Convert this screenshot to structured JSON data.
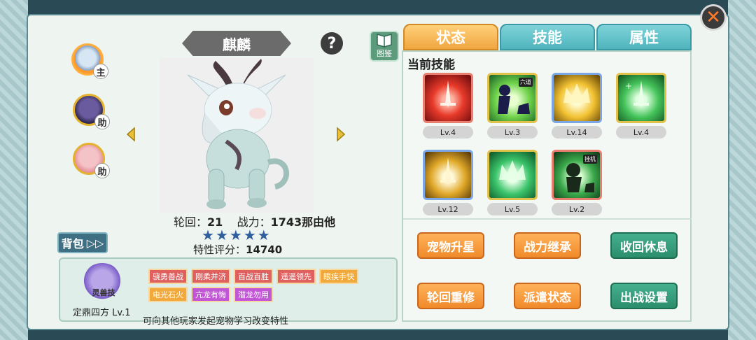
{
  "pet": {
    "name": "麒麟",
    "reincarnation_label": "轮回：",
    "reincarnation": "21",
    "power_label": "战力：",
    "power": "1743那由他",
    "stars": 5,
    "trait_score_label": "特性评分：",
    "trait_score": "14740"
  },
  "roles": [
    {
      "tag": "主"
    },
    {
      "tag": "助"
    },
    {
      "tag": "助"
    }
  ],
  "bag": {
    "label": "背包"
  },
  "atlas": {
    "label": "图鉴"
  },
  "help": {
    "label": "?"
  },
  "trait": {
    "emblem_text": "灵兽技",
    "name": "定鼎四方 Lv.1",
    "tags": [
      {
        "label": "骁勇善战",
        "color": "red"
      },
      {
        "label": "刚柔并济",
        "color": "red"
      },
      {
        "label": "百战百胜",
        "color": "red"
      },
      {
        "label": "遥遥领先",
        "color": "red"
      },
      {
        "label": "眼疾手快",
        "color": "orange"
      },
      {
        "label": "电光石火",
        "color": "orange"
      },
      {
        "label": "亢龙有悔",
        "color": "purple"
      },
      {
        "label": "潜龙勿用",
        "color": "purple"
      }
    ],
    "note": "可向其他玩家发起宠物学习改变特性"
  },
  "tabs": [
    {
      "label": "状态",
      "active": true
    },
    {
      "label": "技能",
      "active": false
    },
    {
      "label": "属性",
      "active": false
    }
  ],
  "skills_header": "当前技能",
  "skills": [
    {
      "level": "Lv.4",
      "theme": "red",
      "badge": ""
    },
    {
      "level": "Lv.3",
      "theme": "green-shadow",
      "badge": "六道"
    },
    {
      "level": "Lv.14",
      "theme": "gold",
      "badge": ""
    },
    {
      "level": "Lv.4",
      "theme": "green",
      "badge": ""
    },
    {
      "level": "Lv.12",
      "theme": "gold-sword",
      "badge": ""
    },
    {
      "level": "Lv.5",
      "theme": "green-crown",
      "badge": ""
    },
    {
      "level": "Lv.2",
      "theme": "green-dark",
      "badge": "挂机"
    }
  ],
  "actions": [
    {
      "label": "宠物升星",
      "style": "orange"
    },
    {
      "label": "战力继承",
      "style": "orange"
    },
    {
      "label": "收回休息",
      "style": "green"
    },
    {
      "label": "轮回重修",
      "style": "orange"
    },
    {
      "label": "派遣状态",
      "style": "orange"
    },
    {
      "label": "出战设置",
      "style": "green"
    }
  ]
}
